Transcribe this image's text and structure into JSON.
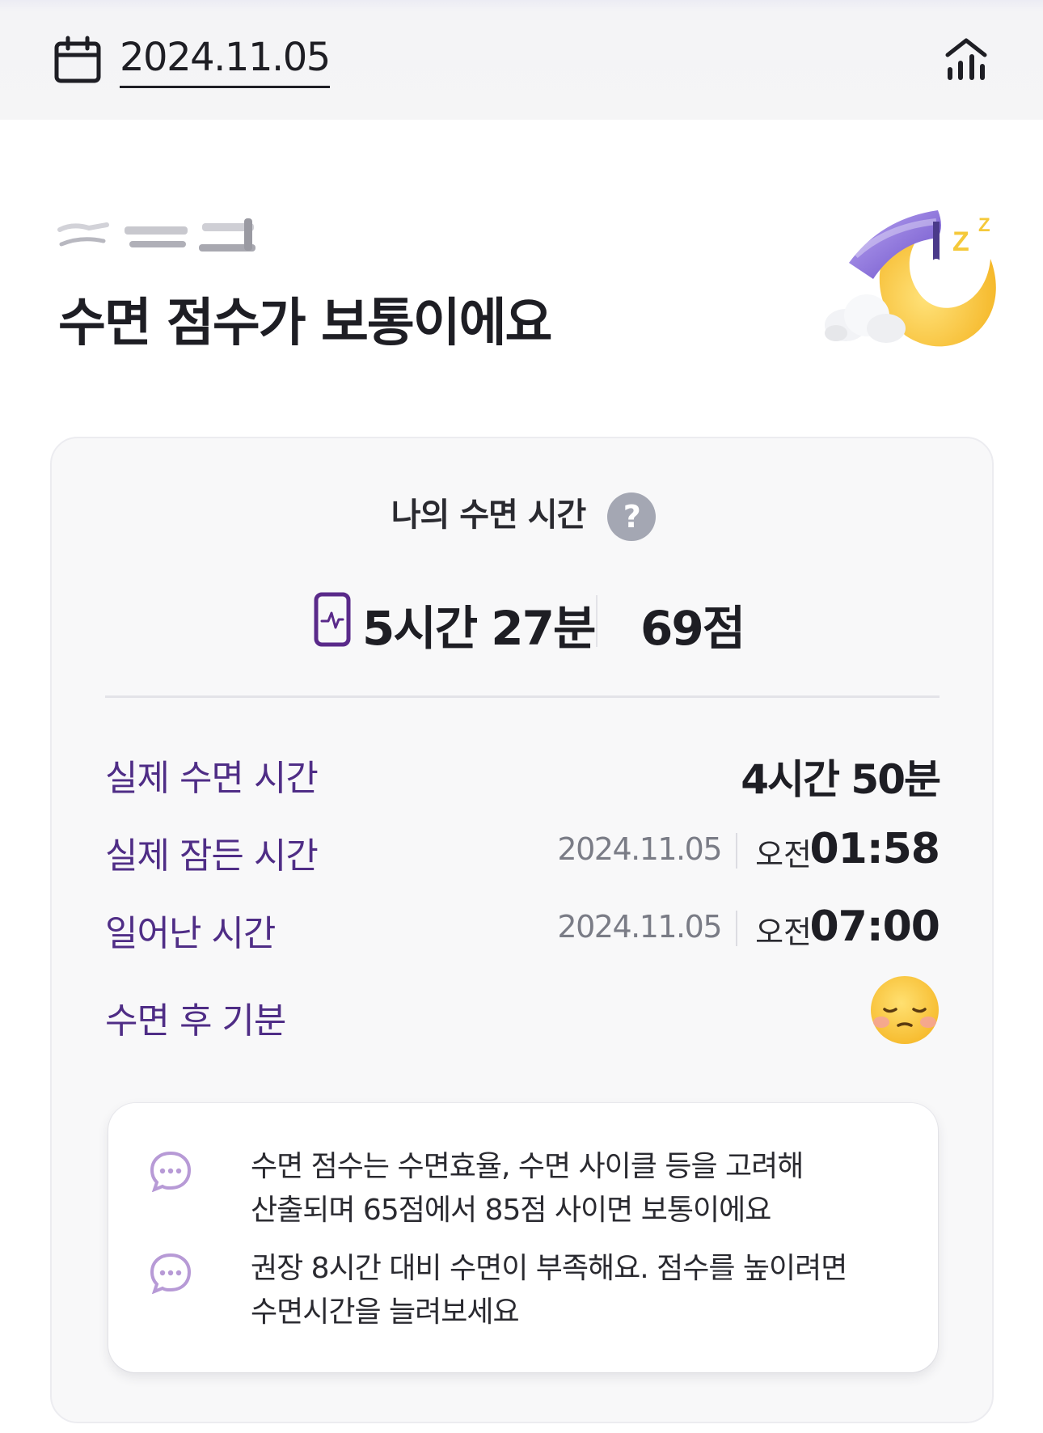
{
  "header": {
    "date": "2024.11.05",
    "calendar_icon": "calendar-icon",
    "stats_icon": "bar-chart-icon"
  },
  "hero": {
    "headline": "수면 점수가 보통이에요",
    "illustration": "sleeping-moon-nightcap"
  },
  "card": {
    "title": "나의 수면 시간",
    "help_label": "?",
    "total_time": "5시간 27분",
    "score": "69점",
    "rows": {
      "actual_sleep": {
        "label": "실제 수면 시간",
        "value": "4시간 50분"
      },
      "fell_asleep": {
        "label": "실제 잠든 시간",
        "date": "2024.11.05",
        "ampm": "오전",
        "time": "01:58"
      },
      "woke_up": {
        "label": "일어난 시간",
        "date": "2024.11.05",
        "ampm": "오전",
        "time": "07:00"
      },
      "mood": {
        "label": "수면 후 기분",
        "icon": "sleepy-face-icon"
      }
    },
    "tips": [
      {
        "line1": "수면 점수는 수면효율, 수면 사이클 등을 고려해",
        "line2": "산출되며 65점에서 85점 사이면 보통이에요"
      },
      {
        "line1": "권장 8시간 대비 수면이 부족해요. 점수를 높이려면",
        "line2": "수면시간을 늘려보세요"
      }
    ]
  },
  "colors": {
    "accent_purple": "#4f2d86",
    "phone_icon": "#5a2a8a",
    "tip_icon": "#b79ad6",
    "card_bg": "#f8f8f9"
  }
}
